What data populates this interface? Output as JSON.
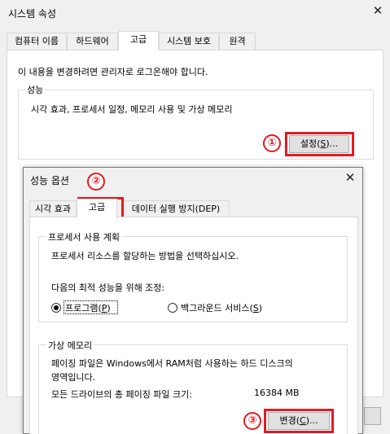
{
  "outer": {
    "title": "시스템 속성",
    "close_glyph": "✕",
    "tabs": [
      "컴퓨터 이름",
      "하드웨어",
      "고급",
      "시스템 보호",
      "원격"
    ],
    "admin_note": "이 내용을 변경하려면 관리자로 로그온해야 합니다.",
    "perf_group_title": "성능",
    "perf_desc": "시각 효과, 프로세서 일정, 메모리 사용 및 가상 메모리",
    "settings_button": {
      "label": "설정(",
      "accel": "S",
      "suffix": ")..."
    },
    "marker_1": "①"
  },
  "inner": {
    "title": "성능 옵션",
    "close_glyph": "✕",
    "marker_2": "②",
    "tabs": [
      "시각 효과",
      "고급",
      "데이터 실행 방지(DEP)"
    ],
    "processor_group": {
      "title": "프로세서 사용 계획",
      "desc": "프로세서 리소스를 할당하는 방법을 선택하십시오.",
      "adjust_label": "다음의 최적 성능을 위해 조정:",
      "option_programs": {
        "label": "프로그램(",
        "accel": "P",
        "suffix": ")"
      },
      "option_background": {
        "label": "백그라운드 서비스(",
        "accel": "S",
        "suffix": ")"
      }
    },
    "vm_group": {
      "title": "가상 메모리",
      "desc_line1": "페이징 파일은 Windows에서 RAM처럼 사용하는 하드 디스크의",
      "desc_line2": "영역입니다.",
      "total_label": "모든 드라이브의 총 페이징 파일 크기:",
      "total_value": "16384 MB",
      "change_button": {
        "label": "변경(",
        "accel": "C",
        "suffix": ")..."
      }
    },
    "marker_3": "③"
  },
  "colors": {
    "highlight": "#e01b22"
  }
}
